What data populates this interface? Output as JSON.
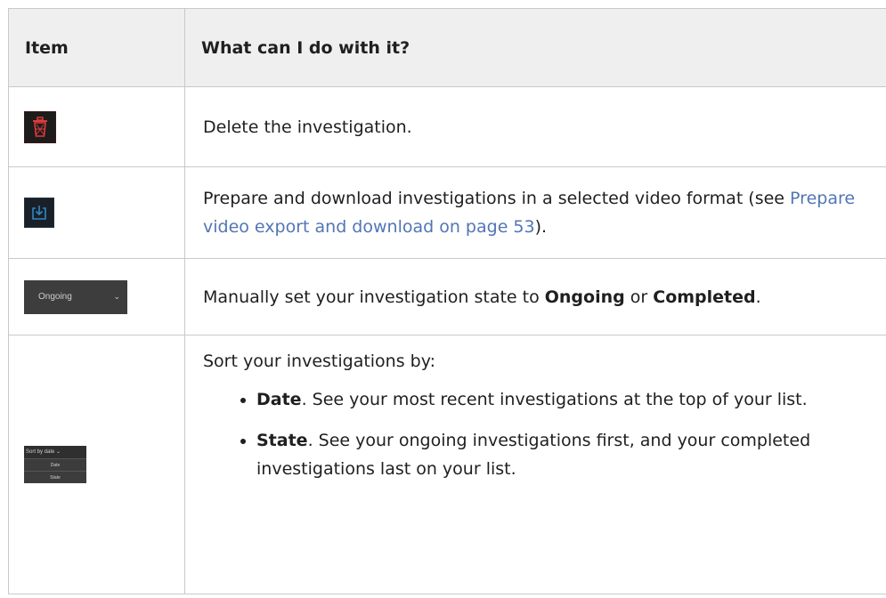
{
  "table": {
    "headers": {
      "item": "Item",
      "description": "What can I do with it?"
    },
    "rows": [
      {
        "icon": "trash-icon",
        "description": "Delete the investigation."
      },
      {
        "icon": "download-icon",
        "description_prefix": "Prepare and download investigations in a selected video format (see ",
        "link_text": "Prepare video export and download on page 53",
        "description_suffix": ")."
      },
      {
        "thumbnail_label": "Ongoing",
        "thumbnail_chevron": "⌄",
        "description_prefix": "Manually set your investigation state to ",
        "option_1": "Ongoing",
        "or_text": " or ",
        "option_2": "Completed",
        "description_suffix": "."
      },
      {
        "thumbnail_header": "Sort by date ⌄",
        "thumbnail_options": [
          "Date",
          "State"
        ],
        "intro": "Sort your investigations by:",
        "bullets": [
          {
            "term": "Date",
            "text": ". See your most recent investigations at the top of your list."
          },
          {
            "term": "State",
            "text": ". See your ongoing investigations first, and your completed investigations last on your list."
          }
        ]
      }
    ]
  },
  "colors": {
    "header_bg": "#efefef",
    "border": "#c9c9c9",
    "link": "#5176b5",
    "delete_icon": "#e23a3a",
    "download_icon": "#2f86c9"
  }
}
